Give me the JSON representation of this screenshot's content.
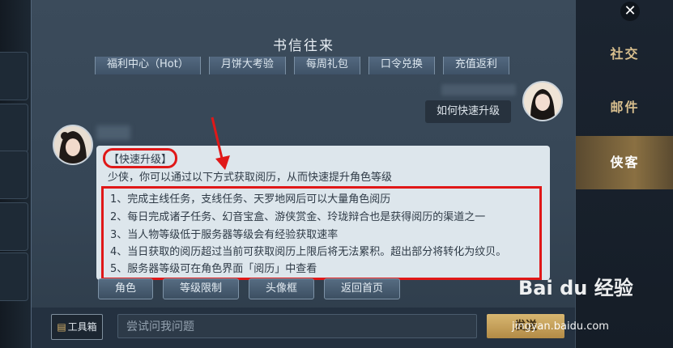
{
  "window": {
    "title": "书信往来"
  },
  "quick_links": [
    "福利中心（Hot）",
    "月饼大考验",
    "每周礼包",
    "口令兑换",
    "充值返利"
  ],
  "chat": {
    "user_message": "如何快速升级",
    "npc_reply": {
      "title": "【快速升级】",
      "intro": "少侠，你可以通过以下方式获取阅历，从而快速提升角色等级",
      "tips": [
        "1、完成主线任务，支线任务、天罗地网后可以大量角色阅历",
        "2、每日完成诸子任务、幻音宝盒、游侠赏金、玲珑辩合也是获得阅历的渠道之一",
        "3、当人物等级低于服务器等级会有经验获取速率",
        "4、当日获取的阅历超过当前可获取阅历上限后将无法累积。超出部分将转化为纹贝。",
        "5、服务器等级可在角色界面「阅历」中查看"
      ]
    }
  },
  "actions": [
    "角色",
    "等级限制",
    "头像框",
    "返回首页"
  ],
  "bottom": {
    "toolbox_label": "工具箱",
    "input_placeholder": "尝试问我问题",
    "send_label": "发送"
  },
  "side_tabs": [
    "社交",
    "邮件",
    "侠客"
  ],
  "close_label": "✕",
  "watermark": {
    "brand": "Bai du 经验",
    "url": "jingyan.baidu.com"
  },
  "colors": {
    "highlight": "#e01818",
    "active_tab": "#8a7042",
    "bubble": "#dde6ec"
  }
}
